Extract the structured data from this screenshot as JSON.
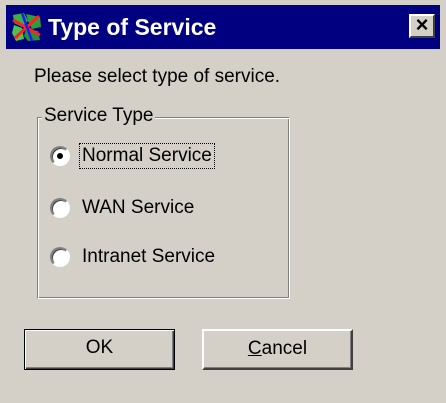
{
  "window": {
    "title": "Type of Service",
    "icon": "app-icon",
    "close_label": "×"
  },
  "prompt": "Please select type of service.",
  "service_group": {
    "label": "Service Type",
    "options": [
      {
        "label": "Normal Service",
        "selected": true
      },
      {
        "label": "WAN Service",
        "selected": false
      },
      {
        "label": "Intranet Service",
        "selected": false
      }
    ]
  },
  "buttons": {
    "ok_label": "OK",
    "cancel_label": "Cancel"
  },
  "colors": {
    "titlebar": "#000080",
    "face": "#d4d0c8"
  }
}
